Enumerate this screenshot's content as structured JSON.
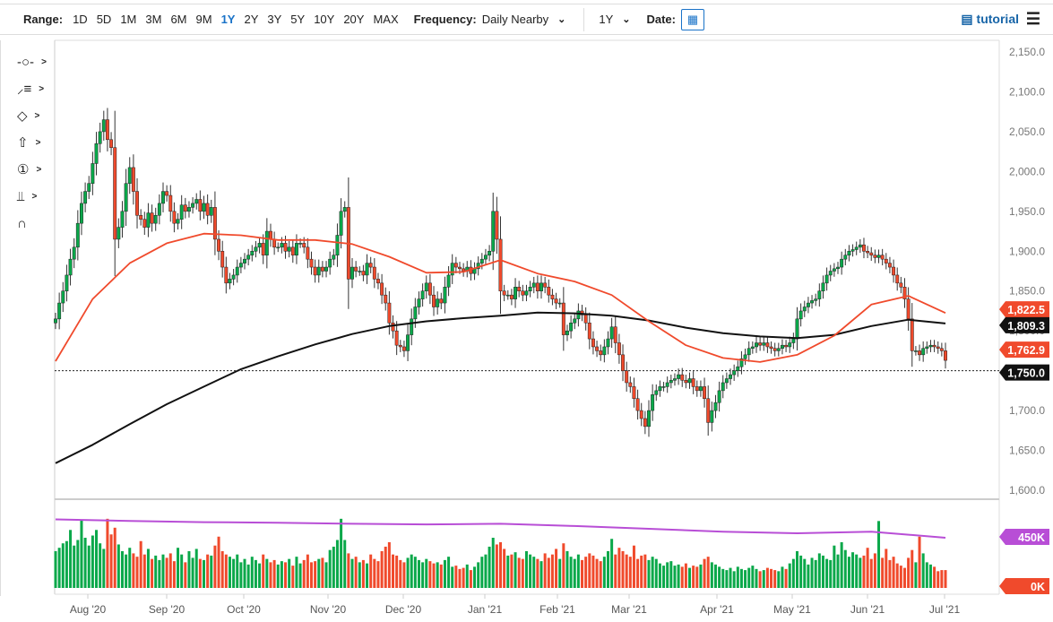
{
  "toolbar": {
    "range_label": "Range:",
    "ranges": [
      "1D",
      "5D",
      "1M",
      "3M",
      "6M",
      "9M",
      "1Y",
      "2Y",
      "3Y",
      "5Y",
      "10Y",
      "20Y",
      "MAX"
    ],
    "active_range": "1Y",
    "frequency_label": "Frequency:",
    "frequency_value": "Daily Nearby",
    "period_value": "1Y",
    "date_label": "Date:",
    "tutorial_label": "tutorial",
    "icons": {
      "calendar": "calendar-icon",
      "tutorial": "film-icon",
      "menu": "hamburger-menu-icon"
    }
  },
  "drawing_tools": [
    "line-tool-icon",
    "fibonacci-tool-icon",
    "shape-tool-icon",
    "arrow-tool-icon",
    "numbered-marker-icon",
    "measure-tool-icon",
    "magnet-icon"
  ],
  "colors": {
    "up": "#0aa84a",
    "down": "#f04a2c",
    "sma50": "#f04a2c",
    "sma200": "#111111",
    "volume_avg": "#b84ed6",
    "axis_text": "#777777"
  },
  "chart_data": {
    "type": "candlestick",
    "frequency": "Daily",
    "ylim": [
      1600,
      2150
    ],
    "y_ticks": [
      "2,150.0",
      "2,100.0",
      "2,050.0",
      "2,000.0",
      "1,950.0",
      "1,900.0",
      "1,850.0",
      "1,800.0",
      "1,750.0",
      "1,700.0",
      "1,650.0",
      "1,600.0"
    ],
    "x_ticks": [
      "Aug '20",
      "Sep '20",
      "Oct '20",
      "Nov '20",
      "Dec '20",
      "Jan '21",
      "Feb '21",
      "Mar '21",
      "Apr '21",
      "May '21",
      "Jun '21",
      "Jul '21"
    ],
    "close": [
      1815,
      1835,
      1850,
      1870,
      1890,
      1905,
      1935,
      1960,
      1975,
      1985,
      2010,
      2035,
      2050,
      2065,
      2040,
      2030,
      1915,
      1930,
      1950,
      1985,
      2005,
      1975,
      1945,
      1940,
      1930,
      1948,
      1935,
      1945,
      1960,
      1975,
      1970,
      1950,
      1935,
      1940,
      1958,
      1950,
      1955,
      1960,
      1965,
      1950,
      1960,
      1945,
      1955,
      1915,
      1900,
      1880,
      1860,
      1865,
      1870,
      1880,
      1885,
      1890,
      1895,
      1900,
      1905,
      1910,
      1895,
      1925,
      1915,
      1905,
      1905,
      1910,
      1900,
      1905,
      1895,
      1910,
      1910,
      1905,
      1890,
      1880,
      1870,
      1880,
      1875,
      1880,
      1890,
      1895,
      1920,
      1950,
      1955,
      1865,
      1880,
      1875,
      1875,
      1870,
      1885,
      1880,
      1865,
      1860,
      1845,
      1835,
      1810,
      1800,
      1782,
      1780,
      1775,
      1795,
      1815,
      1830,
      1840,
      1850,
      1860,
      1845,
      1830,
      1840,
      1835,
      1855,
      1870,
      1885,
      1880,
      1878,
      1875,
      1880,
      1872,
      1878,
      1885,
      1890,
      1895,
      1900,
      1950,
      1915,
      1850,
      1845,
      1845,
      1840,
      1855,
      1850,
      1845,
      1850,
      1855,
      1860,
      1850,
      1860,
      1855,
      1845,
      1840,
      1835,
      1835,
      1795,
      1800,
      1810,
      1815,
      1825,
      1820,
      1810,
      1790,
      1780,
      1775,
      1770,
      1780,
      1790,
      1805,
      1785,
      1770,
      1750,
      1735,
      1730,
      1715,
      1700,
      1690,
      1680,
      1700,
      1720,
      1725,
      1730,
      1730,
      1735,
      1738,
      1740,
      1745,
      1738,
      1735,
      1740,
      1730,
      1725,
      1730,
      1715,
      1685,
      1700,
      1710,
      1725,
      1735,
      1740,
      1745,
      1750,
      1755,
      1765,
      1770,
      1778,
      1780,
      1785,
      1782,
      1785,
      1780,
      1778,
      1775,
      1778,
      1782,
      1780,
      1785,
      1790,
      1815,
      1825,
      1830,
      1835,
      1838,
      1840,
      1850,
      1860,
      1870,
      1875,
      1878,
      1880,
      1890,
      1895,
      1900,
      1902,
      1905,
      1908,
      1900,
      1898,
      1895,
      1892,
      1895,
      1890,
      1885,
      1880,
      1870,
      1860,
      1855,
      1840,
      1815,
      1775,
      1775,
      1770,
      1778,
      1780,
      1782,
      1780,
      1778,
      1775,
      1763
    ],
    "volume_k": [
      330,
      360,
      400,
      420,
      520,
      380,
      430,
      610,
      450,
      380,
      470,
      520,
      400,
      350,
      620,
      480,
      540,
      390,
      330,
      300,
      360,
      310,
      280,
      420,
      300,
      350,
      260,
      290,
      250,
      300,
      270,
      310,
      240,
      360,
      300,
      230,
      330,
      270,
      350,
      260,
      250,
      300,
      290,
      380,
      460,
      330,
      300,
      280,
      260,
      300,
      230,
      260,
      210,
      280,
      250,
      220,
      300,
      260,
      230,
      250,
      210,
      240,
      230,
      260,
      200,
      280,
      220,
      250,
      300,
      230,
      240,
      260,
      270,
      230,
      340,
      370,
      430,
      620,
      430,
      310,
      260,
      280,
      230,
      250,
      220,
      300,
      260,
      240,
      330,
      370,
      410,
      300,
      290,
      250,
      230,
      270,
      300,
      280,
      250,
      230,
      260,
      240,
      220,
      230,
      210,
      250,
      280,
      190,
      200,
      170,
      180,
      210,
      160,
      190,
      230,
      280,
      300,
      370,
      450,
      390,
      410,
      350,
      290,
      300,
      320,
      270,
      260,
      330,
      300,
      280,
      260,
      240,
      310,
      270,
      300,
      350,
      260,
      400,
      330,
      280,
      260,
      300,
      250,
      280,
      310,
      290,
      260,
      240,
      280,
      330,
      440,
      300,
      360,
      330,
      300,
      280,
      380,
      260,
      290,
      300,
      250,
      280,
      260,
      220,
      200,
      230,
      240,
      200,
      210,
      190,
      220,
      180,
      200,
      190,
      210,
      260,
      280,
      230,
      210,
      190,
      170,
      160,
      180,
      150,
      190,
      170,
      160,
      180,
      200,
      170,
      150,
      160,
      180,
      170,
      160,
      150,
      190,
      170,
      220,
      260,
      330,
      290,
      260,
      210,
      270,
      250,
      310,
      290,
      260,
      250,
      380,
      300,
      410,
      340,
      280,
      320,
      300,
      270,
      290,
      360,
      260,
      310,
      600,
      270,
      350,
      250,
      280,
      220,
      200,
      180,
      270,
      340,
      230,
      460,
      310,
      230,
      210,
      190,
      150,
      160,
      160
    ],
    "sma50_every_10_bars": [
      1762,
      1840,
      1885,
      1910,
      1922,
      1920,
      1914,
      1914,
      1909,
      1893,
      1873,
      1874,
      1889,
      1872,
      1862,
      1845,
      1812,
      1782,
      1766,
      1761,
      1770,
      1794,
      1833,
      1844,
      1822.5
    ],
    "sma200_every_10_bars": [
      1634,
      1657,
      1683,
      1708,
      1730,
      1752,
      1768,
      1783,
      1796,
      1806,
      1812,
      1816,
      1819,
      1823,
      1822,
      1819,
      1813,
      1804,
      1797,
      1793,
      1791,
      1795,
      1806,
      1814,
      1809.3
    ],
    "volume_avg_every_20_bars": [
      615,
      600,
      590,
      585,
      575,
      570,
      575,
      555,
      530,
      505,
      490,
      505,
      450
    ],
    "reference_line": 1750.0,
    "last_values": {
      "sma50": "1,822.5",
      "sma200": "1,809.3",
      "last": "1,762.9",
      "reference": "1,750.0",
      "volume_avg": "450K",
      "volume_zero": "0K"
    },
    "grid": false
  }
}
